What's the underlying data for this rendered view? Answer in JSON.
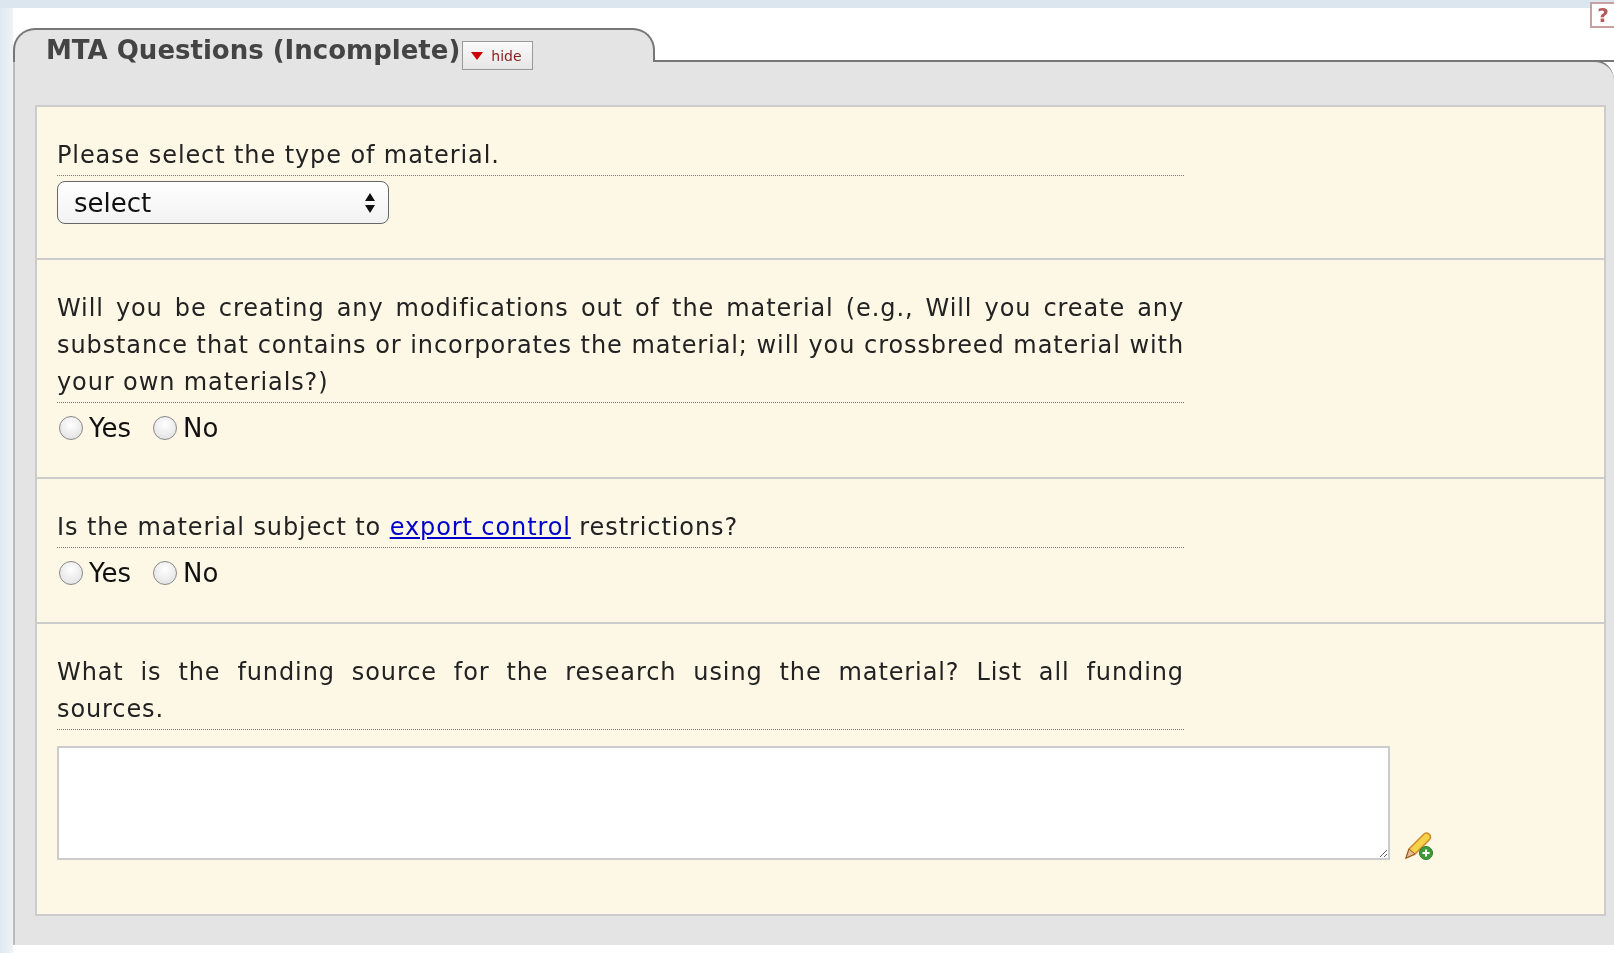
{
  "help_icon": "?",
  "panel": {
    "title": "MTA Questions (Incomplete)",
    "toggle": {
      "label": "hide",
      "expanded": true
    }
  },
  "questions": [
    {
      "kind": "select",
      "label": [
        {
          "kind": "text",
          "text": "Please select the type of material."
        }
      ],
      "value": "select"
    },
    {
      "kind": "radio",
      "label": [
        {
          "kind": "text",
          "text": "Will you be creating any modifications out of the material (e.g., Will you create any substance that contains or incorporates the material; will you crossbreed material with your own materials?)"
        }
      ],
      "options": [
        {
          "label": "Yes",
          "selected": false
        },
        {
          "label": "No",
          "selected": false
        }
      ]
    },
    {
      "kind": "radio",
      "label": [
        {
          "kind": "text",
          "text": "Is the material subject to "
        },
        {
          "kind": "link",
          "text": "export control"
        },
        {
          "kind": "text",
          "text": " restrictions?"
        }
      ],
      "options": [
        {
          "label": "Yes",
          "selected": false
        },
        {
          "label": "No",
          "selected": false
        }
      ]
    },
    {
      "kind": "textarea",
      "label": [
        {
          "kind": "text",
          "text": "What is the funding source for the research using the material? List all funding sources."
        }
      ]
    }
  ]
}
